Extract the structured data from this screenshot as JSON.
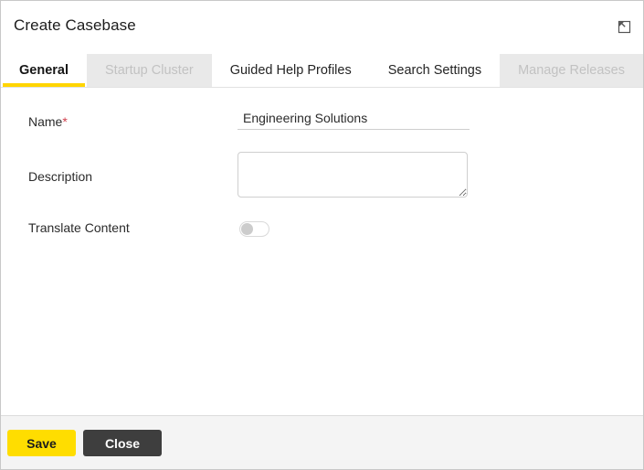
{
  "window": {
    "title": "Create Casebase",
    "expand_icon": "restore-window-icon",
    "accent_color": "#ffd500",
    "border_color": "#c8c8c8"
  },
  "tabs": [
    {
      "label": "General",
      "state": "active"
    },
    {
      "label": "Startup Cluster",
      "state": "disabled"
    },
    {
      "label": "Guided Help Profiles",
      "state": "normal"
    },
    {
      "label": "Search Settings",
      "state": "normal"
    },
    {
      "label": "Manage Releases",
      "state": "disabled"
    }
  ],
  "form": {
    "name": {
      "label": "Name",
      "required_marker": "*",
      "value": "Engineering Solutions",
      "placeholder": ""
    },
    "description": {
      "label": "Description",
      "value": "",
      "placeholder": ""
    },
    "translate_content": {
      "label": "Translate Content",
      "value": "off"
    }
  },
  "footer": {
    "save_label": "Save",
    "close_label": "Close",
    "save_color": "#ffdd00",
    "close_color": "#3e3e3e"
  }
}
